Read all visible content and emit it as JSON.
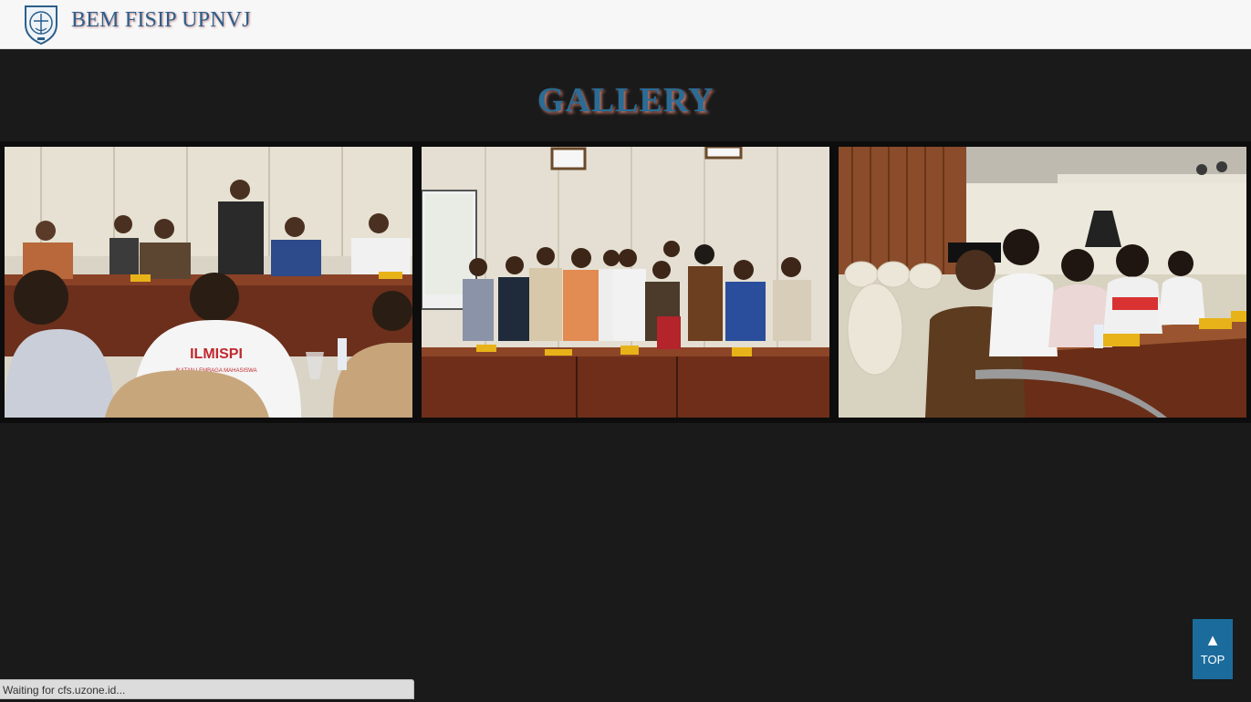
{
  "header": {
    "brand": "BEM FISIP UPNVJ",
    "logo_icon": "university-crest-icon"
  },
  "gallery": {
    "title": "GALLERY",
    "photos": [
      {
        "name": "photo-meeting-table",
        "caption_text": "ILMISPI",
        "caption_sub": "IKATAN LEMBAGA MAHASISWA ILMU SOSIAL & ILMU POLITIK"
      },
      {
        "name": "photo-group-standing"
      },
      {
        "name": "photo-delegates-seated"
      }
    ]
  },
  "top_button": {
    "arrow": "▲",
    "label": "TOP"
  },
  "status": {
    "text": "Waiting for cfs.uzone.id..."
  },
  "colors": {
    "navbar_bg": "#f7f7f7",
    "page_bg": "#1a1a1a",
    "title_blue": "#2a6c95",
    "top_button_bg": "#1b6c9c"
  }
}
